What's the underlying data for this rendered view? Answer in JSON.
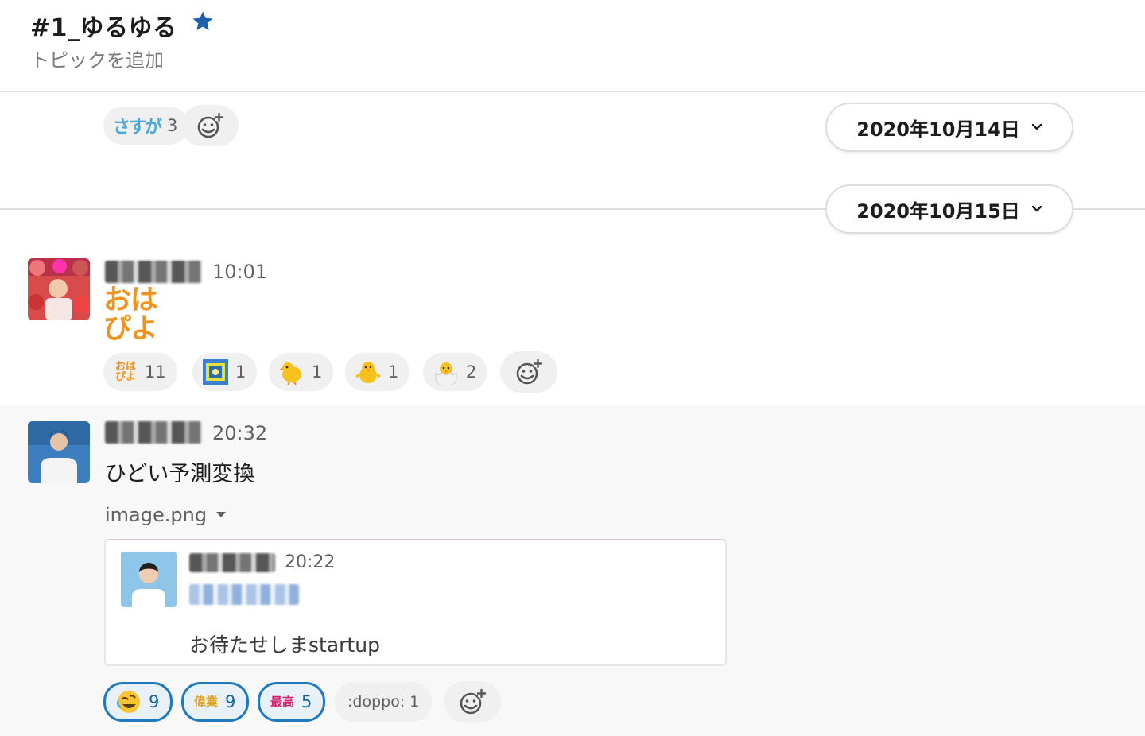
{
  "channel": {
    "name": "#1_ゆるゆる",
    "topic_placeholder": "トピックを追加",
    "star_icon": "star-icon",
    "accent_color": "#1264a3"
  },
  "reactions_top": [
    {
      "emoji": "さすが",
      "count": "3"
    }
  ],
  "date_dividers": [
    {
      "label": "2020年10月14日"
    },
    {
      "label": "2020年10月15日"
    }
  ],
  "message1": {
    "time": "10:01",
    "emoji_text": "おはぴよ",
    "reactions": [
      {
        "emoji": "おはぴよ",
        "count": "11"
      },
      {
        "emoji": "blue-stamp",
        "count": "1"
      },
      {
        "emoji": "chick-side",
        "count": "1"
      },
      {
        "emoji": "chick-front",
        "count": "1"
      },
      {
        "emoji": "hatching-chick",
        "count": "2"
      }
    ]
  },
  "message2": {
    "time": "20:32",
    "text": "ひどい予測変換",
    "file_name": "image.png",
    "attachment": {
      "time": "20:22",
      "text": "お待たせしまstartup"
    },
    "reactions": [
      {
        "emoji": "rolling-laughing",
        "count": "9"
      },
      {
        "emoji": "偉業",
        "count": "9"
      },
      {
        "emoji": "最高",
        "count": "5"
      },
      {
        "emoji": ":doppo:",
        "count": "1",
        "label": ":doppo: 1"
      }
    ]
  }
}
